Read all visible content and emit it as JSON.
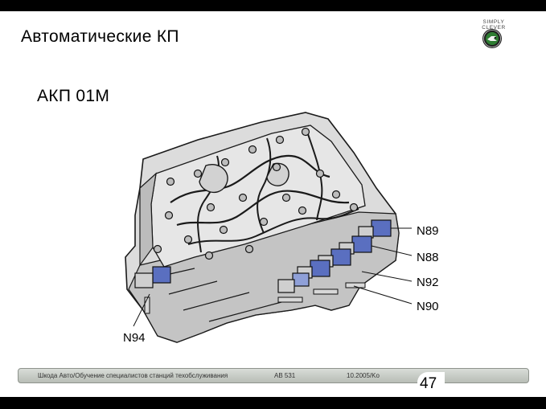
{
  "slide": {
    "title": "Автоматические КП",
    "subtitle": "АКП 01М"
  },
  "logo": {
    "tagline": "SIMPLY CLEVER",
    "icon": "skoda-logo-icon"
  },
  "diagram": {
    "icon": "valve-body-icon",
    "labels": {
      "n89": "N89",
      "n88": "N88",
      "n92": "N92",
      "n90": "N90",
      "n94": "N94"
    }
  },
  "footer": {
    "course": "Шкода Авто/Обучение специалистов станций техобслуживания",
    "code": "AB 531",
    "date": "10.2005/Ko",
    "page": "47"
  },
  "colors": {
    "accent_blue": "#5a6fc0",
    "frame": "#000000"
  }
}
